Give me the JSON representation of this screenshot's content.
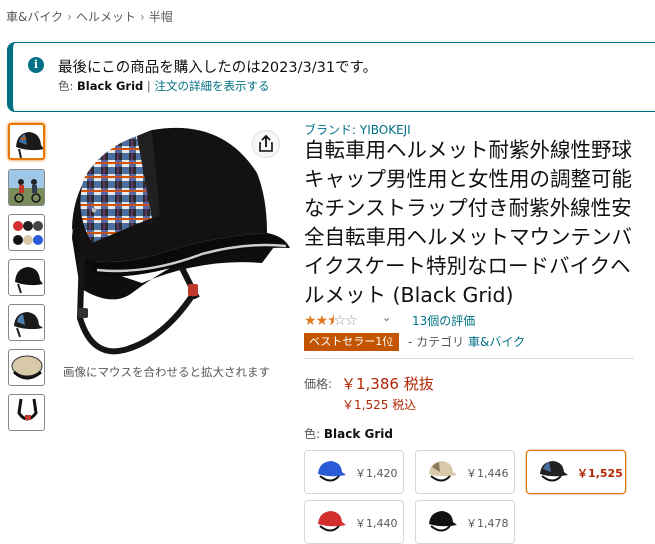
{
  "breadcrumb": [
    "車&バイク",
    "ヘルメット",
    "半帽"
  ],
  "notice": {
    "icon": "info-icon",
    "message": "最後にこの商品を購入したのは2023/3/31です。",
    "color_prefix": "色:",
    "color_value": "Black Grid",
    "separator": "|",
    "details_link": "注文の詳細を表示する"
  },
  "gallery": {
    "thumbnails": [
      "black-grid-helmet",
      "cyclists-photo",
      "color-variants",
      "black-helmet",
      "grid-helmet-side",
      "visor-closeup",
      "strap-detail"
    ],
    "zoom_hint": "画像にマウスを合わせると拡大されます",
    "share_icon": "share-icon"
  },
  "product": {
    "brand": "ブランド: YIBOKEJI",
    "title": "自転車用ヘルメット耐紫外線性野球キャップ男性用と女性用の調整可能なチンストラップ付き耐紫外線性安全自転車用ヘルメットマウンテンバイクスケート特別なロードバイクヘルメット (Black Grid)",
    "rating": 2.5,
    "rating_count": "13個の評価",
    "bestseller_badge": "ベストセラー1位",
    "category_prefix": "- カテゴリ",
    "category_link": "車&バイク"
  },
  "price": {
    "label": "価格:",
    "main": "￥1,386 税抜",
    "with_tax": "￥1,525 税込"
  },
  "colors": {
    "label": "色:",
    "selected": "Black Grid",
    "options": [
      {
        "price": "￥1,420",
        "color": "#2a5bd7"
      },
      {
        "price": "￥1,446",
        "color": "#d8c9a8"
      },
      {
        "price": "￥1,525",
        "color": "#222222"
      },
      {
        "price": "￥1,440",
        "color": "#d32f2f"
      },
      {
        "price": "￥1,478",
        "color": "#111111"
      }
    ]
  },
  "accent_colors": {
    "link": "#007185",
    "price": "#b12704",
    "badge": "#c45500",
    "star": "#de7921"
  }
}
